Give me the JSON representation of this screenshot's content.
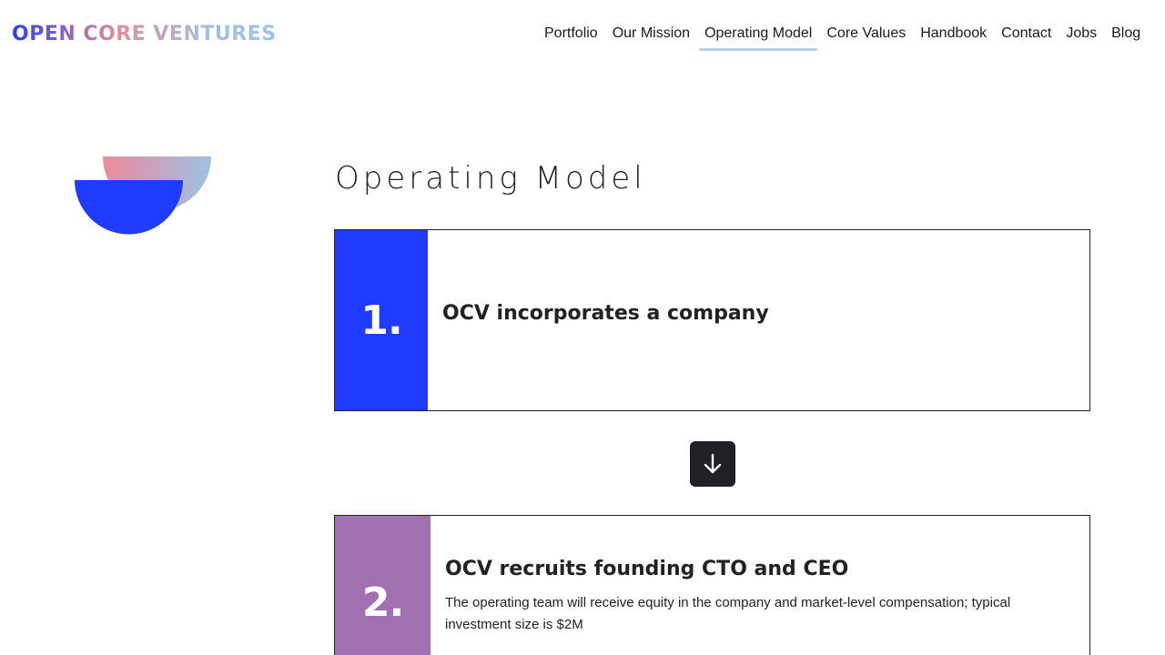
{
  "header": {
    "logo_text": "OPEN CORE VENTURES",
    "nav": [
      {
        "label": "Portfolio"
      },
      {
        "label": "Our Mission"
      },
      {
        "label": "Operating Model",
        "active": true
      },
      {
        "label": "Core Values"
      },
      {
        "label": "Handbook"
      },
      {
        "label": "Contact"
      },
      {
        "label": "Jobs"
      },
      {
        "label": "Blog"
      }
    ]
  },
  "main": {
    "title": "Operating Model",
    "steps": [
      {
        "number": "1.",
        "title": "OCV incorporates a company",
        "description": "",
        "color": "#1f3bff"
      },
      {
        "number": "2.",
        "title": "OCV recruits founding CTO and CEO",
        "description": "The operating team will receive equity in the company and market-level compensation; typical investment size is $2M",
        "color": "#a070b0"
      }
    ],
    "next_icon": "arrow-down-icon"
  },
  "colors": {
    "accent_blue": "#1f3bff",
    "accent_purple": "#a070b0",
    "button_dark": "#1f2124",
    "nav_underline": "#b9cdee"
  }
}
